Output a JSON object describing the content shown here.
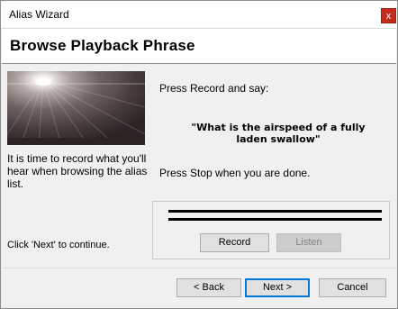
{
  "window": {
    "title": "Alias Wizard",
    "close_glyph": "x"
  },
  "header": {
    "title": "Browse Playback Phrase"
  },
  "left": {
    "description": "It is time to record what you'll hear when browsing the alias list.",
    "continue_hint": "Click 'Next' to continue."
  },
  "main": {
    "instruction_1": "Press Record and say:",
    "phrase": "\"What is the airspeed of a fully laden swallow\"",
    "instruction_2": "Press Stop when you are done."
  },
  "recorder": {
    "record_label": "Record",
    "listen_label": "Listen",
    "listen_enabled": false
  },
  "footer": {
    "back_label": "< Back",
    "next_label": "Next >",
    "cancel_label": "Cancel"
  },
  "colors": {
    "accent_close": "#c42b1c",
    "focus": "#0078d7"
  }
}
